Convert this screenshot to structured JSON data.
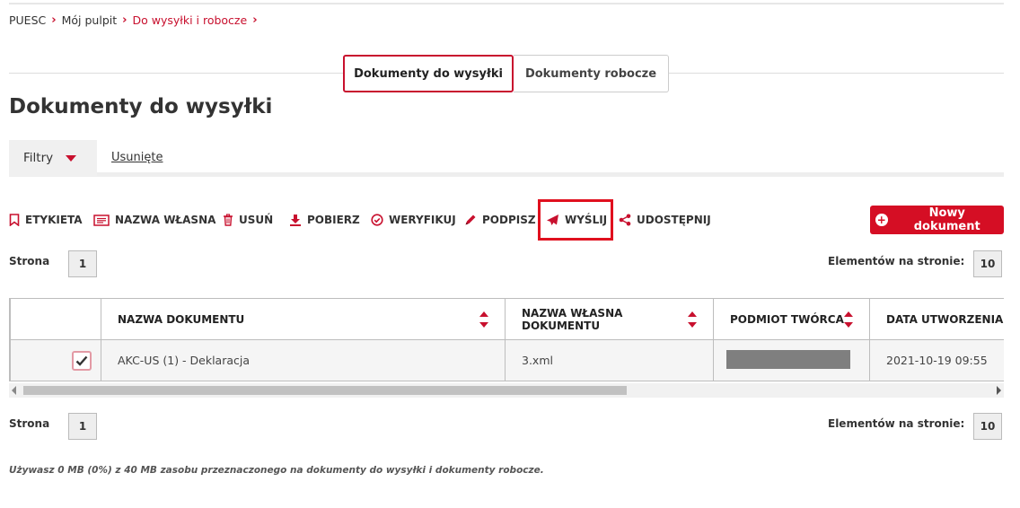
{
  "breadcrumb": [
    {
      "label": "PUESC",
      "active": false
    },
    {
      "label": "Mój pulpit",
      "active": false
    },
    {
      "label": "Do wysyłki i robocze",
      "active": true
    }
  ],
  "tabs": [
    {
      "label": "Dokumenty do wysyłki",
      "active": true
    },
    {
      "label": "Dokumenty robocze",
      "active": false
    }
  ],
  "page_title": "Dokumenty do wysyłki",
  "filters": {
    "label": "Filtry",
    "deleted_label": "Usunięte"
  },
  "toolbar": {
    "label": "ETYKIETA",
    "own_name": "NAZWA WŁASNA",
    "delete": "USUŃ",
    "download": "POBIERZ",
    "verify": "WERYFIKUJ",
    "sign": "PODPISZ",
    "send": "WYŚLIJ",
    "share": "UDOSTĘPNIJ"
  },
  "new_document_label": "Nowy dokument",
  "pagination": {
    "page_label": "Strona",
    "page_value": "1",
    "per_page_label": "Elementów na stronie:",
    "per_page_value": "10"
  },
  "table": {
    "columns": [
      "NAZWA DOKUMENTU",
      "NAZWA WŁASNA DOKUMENTU",
      "PODMIOT TWÓRCA",
      "DATA UTWORZENIA"
    ],
    "rows": [
      {
        "checked": true,
        "name": "AKC-US (1) - Deklaracja",
        "own_name": "3.xml",
        "creator": "",
        "created": "2021-10-19 09:55"
      }
    ]
  },
  "usage_note": "Używasz 0 MB (0%) z 40 MB zasobu przeznaczonego na dokumenty do wysyłki i dokumenty robocze.",
  "colors": {
    "accent": "#c8102e",
    "button_red": "#d50e24",
    "highlight_box": "#e0101e"
  }
}
